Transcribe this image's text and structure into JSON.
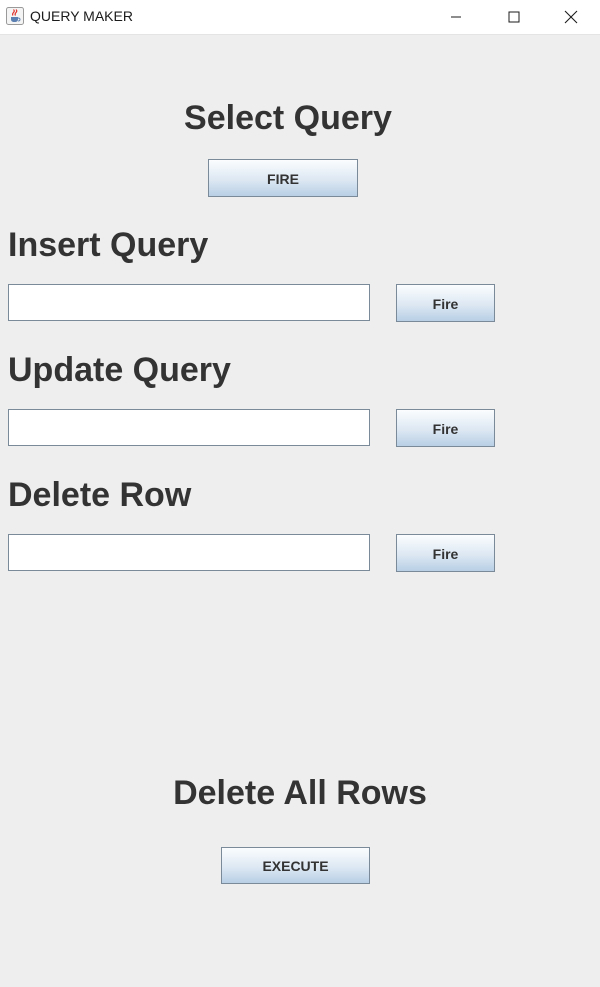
{
  "window": {
    "title": "QUERY MAKER",
    "app_icon": "java-coffee-cup-icon"
  },
  "select_section": {
    "heading": "Select Query",
    "button_label": "FIRE"
  },
  "insert_section": {
    "heading": "Insert Query",
    "input_value": "",
    "button_label": "Fire"
  },
  "update_section": {
    "heading": "Update Query",
    "input_value": "",
    "button_label": "Fire"
  },
  "delete_section": {
    "heading": "Delete Row",
    "input_value": "",
    "button_label": "Fire"
  },
  "delete_all_section": {
    "heading": "Delete All Rows",
    "button_label": "EXECUTE"
  },
  "colors": {
    "background": "#eeeeee",
    "heading_text": "#333333",
    "button_border": "#7a8a99",
    "button_gradient_bottom": "#b8cfe5"
  }
}
